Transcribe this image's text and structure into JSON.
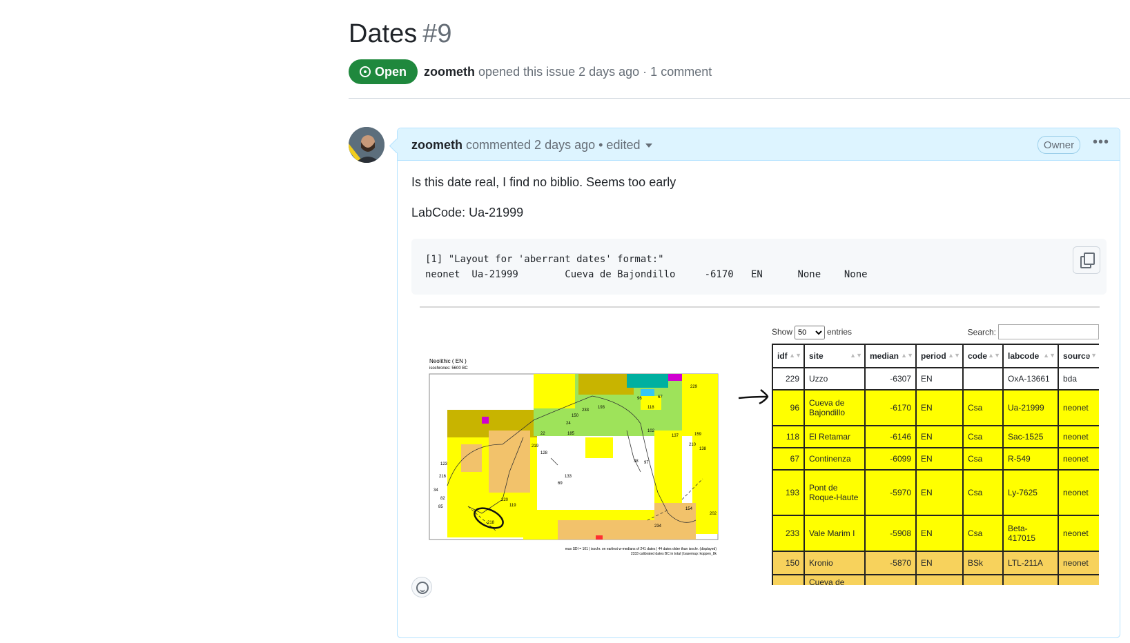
{
  "issue": {
    "title": "Dates",
    "number": "#9",
    "state_label": "Open",
    "author": "zoometh",
    "meta_text": "opened this issue 2 days ago · 1 comment"
  },
  "comment": {
    "author": "zoometh",
    "header_text": "commented 2 days ago • edited",
    "badge": "Owner",
    "body_line1": "Is this date real, I find no biblio. Seems too early",
    "body_line2": "LabCode: Ua-21999",
    "code_line1": "[1] \"Layout for 'aberrant dates' format:\"",
    "code_line2": "neonet  Ua-21999        Cueva de Bajondillo     -6170   EN      None    None"
  },
  "map": {
    "title": "Neolithic ( EN )",
    "subtitle": "isochrones: 5600 BC",
    "footer1": "max SDI = 101 | isochr. on earliest w-medians of 241 dates | 44 dates older than isochr. (displayed)",
    "footer2": "2333 calibrated dates BC in total | basemap: koppen_8k",
    "labels": [
      "229",
      "96",
      "118",
      "67",
      "193",
      "233",
      "150",
      "24",
      "22",
      "219",
      "128",
      "185",
      "133",
      "69",
      "123",
      "216",
      "34",
      "82",
      "85",
      "220",
      "119",
      "234",
      "38",
      "97",
      "102",
      "210",
      "138",
      "137",
      "159",
      "218",
      "202",
      "154"
    ],
    "colors": {
      "yellow": "#ffff00",
      "orange": "#f2c26b",
      "olive": "#c8b400",
      "green": "#9ee35a",
      "teal": "#00b0a0",
      "cyan": "#33c7f5",
      "magenta": "#d000d0",
      "sea": "#ffffff"
    }
  },
  "table": {
    "show_label": "Show",
    "show_value": "50",
    "entries_label": "entries",
    "search_label": "Search:",
    "headers": [
      "idf",
      "site",
      "median",
      "period",
      "code",
      "labcode",
      "source"
    ],
    "rows": [
      {
        "idf": "229",
        "site": "Uzzo",
        "median": "-6307",
        "period": "EN",
        "code": "",
        "labcode": "OxA-13661",
        "source": "bda",
        "color": "white"
      },
      {
        "idf": "96",
        "site": "Cueva de Bajondillo",
        "median": "-6170",
        "period": "EN",
        "code": "Csa",
        "labcode": "Ua-21999",
        "source": "neonet",
        "color": "yellow"
      },
      {
        "idf": "118",
        "site": "El Retamar",
        "median": "-6146",
        "period": "EN",
        "code": "Csa",
        "labcode": "Sac-1525",
        "source": "neonet",
        "color": "yellow"
      },
      {
        "idf": "67",
        "site": "Continenza",
        "median": "-6099",
        "period": "EN",
        "code": "Csa",
        "labcode": "R-549",
        "source": "neonet",
        "color": "yellow"
      },
      {
        "idf": "193",
        "site": "Pont de Roque-Haute",
        "median": "-5970",
        "period": "EN",
        "code": "Csa",
        "labcode": "Ly-7625",
        "source": "neonet",
        "color": "yellow"
      },
      {
        "idf": "233",
        "site": "Vale Marim I",
        "median": "-5908",
        "period": "EN",
        "code": "Csa",
        "labcode": "Beta-417015",
        "source": "neonet",
        "color": "yellow"
      },
      {
        "idf": "150",
        "site": "Kronio",
        "median": "-5870",
        "period": "EN",
        "code": "BSk",
        "labcode": "LTL-211A",
        "source": "neonet",
        "color": "orange"
      },
      {
        "idf": "",
        "site": "Cueva de",
        "median": "",
        "period": "",
        "code": "",
        "labcode": "",
        "source": "",
        "color": "orange"
      }
    ]
  }
}
